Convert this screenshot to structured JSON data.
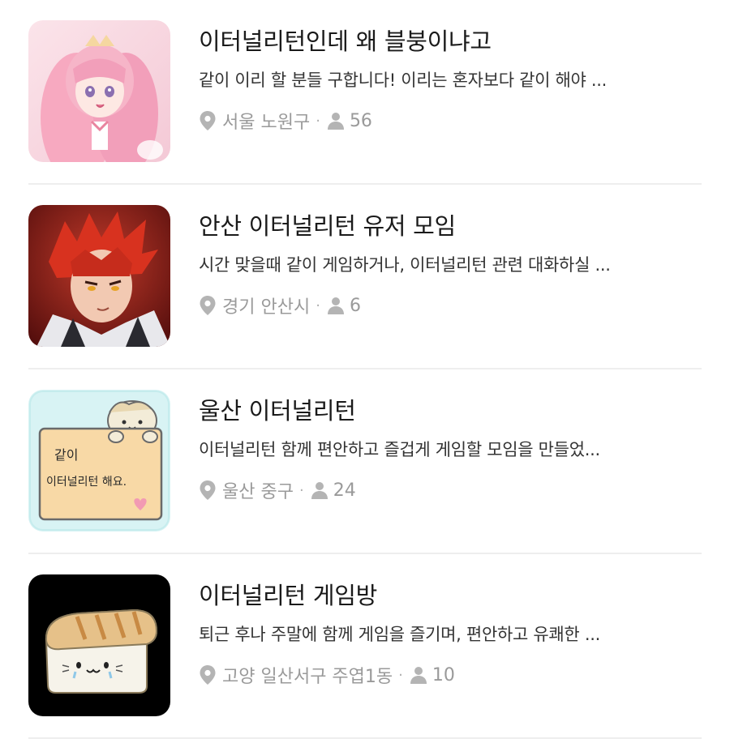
{
  "groups": [
    {
      "title": "이터널리턴인데 왜 블붕이냐고",
      "description": "같이 이리 할 분들 구합니다! 이리는 혼자보다 같이 해야 ...",
      "location": "서울 노원구",
      "members": "56",
      "thumbnail": "pink-haired-anime-girl-illustration"
    },
    {
      "title": "안산 이터널리턴 유저 모임",
      "description": "시간 맞을때 같이 게임하거나, 이터널리턴 관련 대화하실 ...",
      "location": "경기 안산시",
      "members": "6",
      "thumbnail": "red-haired-anime-boy-illustration"
    },
    {
      "title": "울산 이터널리턴",
      "description": "이터널리턴 함께 편안하고 즐겁게 게임할 모임을 만들었...",
      "location": "울산 중구",
      "members": "24",
      "thumbnail": "cat-holding-note",
      "thumbnail_text_line1": "같이",
      "thumbnail_text_line2": "이터널리턴 해요."
    },
    {
      "title": "이터널리턴 게임방",
      "description": "퇴근 후나 주말에 함께 게임을 즐기며, 편안하고 유쾌한 ...",
      "location": "고양 일산서구 주엽1동",
      "members": "10",
      "thumbnail": "bread-cat-on-black"
    }
  ],
  "colors": {
    "title": "#1a1a1a",
    "description": "#333333",
    "meta": "#9a9a9a",
    "divider": "#eeeeee"
  },
  "icons": {
    "location": "location-pin-icon",
    "members": "person-icon"
  }
}
